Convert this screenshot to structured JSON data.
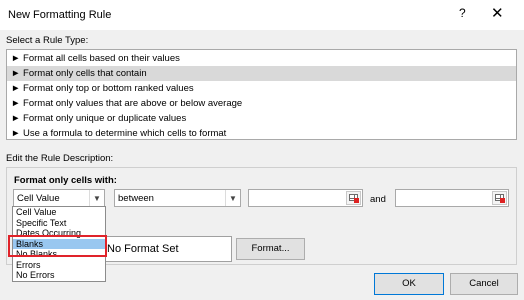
{
  "window": {
    "title": "New Formatting Rule",
    "help": "?",
    "close": "✕"
  },
  "rule_type": {
    "label": "Select a Rule Type:",
    "items": [
      "► Format all cells based on their values",
      "► Format only cells that contain",
      "► Format only top or bottom ranked values",
      "► Format only values that are above or below average",
      "► Format only unique or duplicate values",
      "► Use a formula to determine which cells to format"
    ],
    "selected_index": 1
  },
  "description": {
    "label": "Edit the Rule Description:",
    "format_only_label": "Format only cells with:",
    "condition_select": "Cell Value",
    "operator_select": "between",
    "and_label": "and",
    "value1": "",
    "value2": ""
  },
  "condition_options": {
    "items": [
      "Cell Value",
      "Specific Text",
      "Dates Occurring",
      "Blanks",
      "No Blanks",
      "Errors",
      "No Errors"
    ],
    "selected": "Blanks"
  },
  "preview": {
    "text": "No Format Set"
  },
  "buttons": {
    "format": "Format...",
    "ok": "OK",
    "cancel": "Cancel"
  },
  "colors": {
    "highlight": "#e0232a",
    "selection": "#99c7f0",
    "accent": "#0078d7"
  }
}
